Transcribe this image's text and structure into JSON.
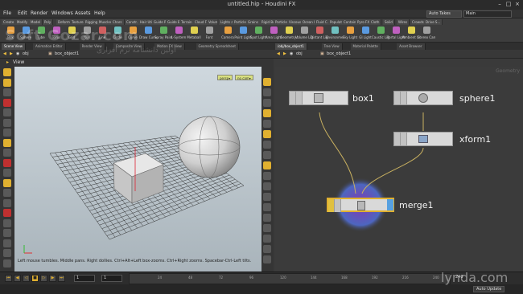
{
  "window": {
    "title": "untitled.hip - Houdini FX"
  },
  "menu": [
    "File",
    "Edit",
    "Render",
    "Windows",
    "Assets",
    "Help"
  ],
  "desktop": {
    "auto_takes": "Auto Takes",
    "main": "Main"
  },
  "shelf": {
    "left_tabs": [
      "Create",
      "Modify",
      "Model",
      "Poly",
      "Deform",
      "Texture",
      "Rigging",
      "Muscles",
      "Chars",
      "Constr.",
      "Hair Utils",
      "Guide Process",
      "Guide Brushes",
      "Terrain FX",
      "Cloud FX",
      "Volume"
    ],
    "left_tools": [
      "Box",
      "Sphere",
      "Tube",
      "Torus",
      "Grid",
      "Null",
      "Line",
      "Circle",
      "Curve",
      "Draw Curve",
      "Spray Paint",
      "L-System",
      "Metaball",
      "Font"
    ],
    "right_tabs": [
      "Lights and...",
      "Particles",
      "Grains",
      "Rigid Bodies",
      "Particle",
      "Viscous",
      "Ocean FX",
      "Fluid C...",
      "Populate...",
      "Container",
      "Pyro FX",
      "Cloth",
      "Solid",
      "Wires",
      "Crowds",
      "Drive S..."
    ],
    "right_tools": [
      "Camera",
      "Point Light",
      "Spot Light",
      "Area Light",
      "Geometry Light",
      "Volume Light",
      "Distant Light",
      "Environment",
      "Sky Light",
      "GI Light",
      "Caustic Light",
      "Portal Light",
      "Ambient Light",
      "Stereo Cam"
    ]
  },
  "panes": {
    "left_tabs": [
      "Scene View",
      "Animation Editor",
      "Render View",
      "Composite View",
      "Motion FX View",
      "Geometry Spreadsheet"
    ],
    "right_tabs": [
      "/obj/box_object1",
      "Tree View",
      "Material Palette",
      "Asset Browser"
    ]
  },
  "left_path": {
    "seg1": "obj",
    "seg2": "box_object1"
  },
  "right_path": {
    "seg1": "obj",
    "seg2": "box_object1"
  },
  "viewport": {
    "label": "View",
    "persp": "persp▾",
    "cam": "no cam▾",
    "hint": "Left mouse tumbles. Middle pans. Right dollies. Ctrl+Alt+Left box-zooms. Ctrl+Right zooms. Spacebar-Ctrl-Left tilts."
  },
  "network": {
    "context": "Geometry",
    "nodes": {
      "box": "box1",
      "sphere": "sphere1",
      "xform": "xform1",
      "merge": "merge1"
    }
  },
  "timeline": {
    "frame_start": "1",
    "frame_current": "1",
    "ticks": [
      "24",
      "48",
      "72",
      "96",
      "120",
      "144",
      "168",
      "192",
      "216",
      "240"
    ],
    "end": "240"
  },
  "status": {
    "auto_update": "Auto Update"
  },
  "watermarks": {
    "soft": "Soft Gozar.com",
    "fa": "اولین دانشنامه نرم افزاری",
    "lynda": "lynda.com"
  },
  "colors": {
    "viewport_bg": "#b8c3c9",
    "node_bg": "#d9d9d9",
    "merge_ring": "#6e4fb5",
    "accent": "#e0b030"
  }
}
